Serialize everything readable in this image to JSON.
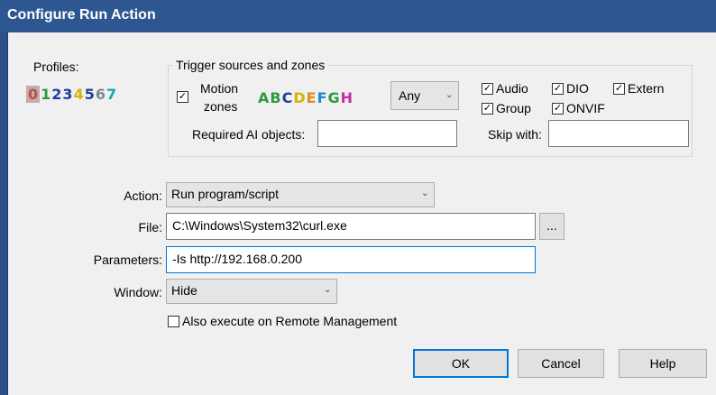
{
  "window": {
    "title": "Configure Run Action"
  },
  "profiles": {
    "label": "Profiles:",
    "items": [
      {
        "label": "0",
        "color": "#b05050"
      },
      {
        "label": "1",
        "color": "#2e9a3a"
      },
      {
        "label": "2",
        "color": "#1a3fa0"
      },
      {
        "label": "3",
        "color": "#1a3fa0"
      },
      {
        "label": "4",
        "color": "#d4b400"
      },
      {
        "label": "5",
        "color": "#1a3fa0"
      },
      {
        "label": "6",
        "color": "#7a8a8a"
      },
      {
        "label": "7",
        "color": "#18a8a8"
      }
    ]
  },
  "trigger": {
    "legend": "Trigger sources and zones",
    "motion_label_line1": "Motion",
    "motion_label_line2": "zones",
    "motion_checked": true,
    "zones": [
      {
        "label": "A",
        "color": "#2e9a3a"
      },
      {
        "label": "B",
        "color": "#2e9a3a"
      },
      {
        "label": "C",
        "color": "#1a3fa0"
      },
      {
        "label": "D",
        "color": "#d4b400"
      },
      {
        "label": "E",
        "color": "#e08a1a"
      },
      {
        "label": "F",
        "color": "#1a8ad0"
      },
      {
        "label": "G",
        "color": "#2e9a3a"
      },
      {
        "label": "H",
        "color": "#c0309a"
      }
    ],
    "zone_mode": "Any",
    "sources": {
      "audio": {
        "label": "Audio",
        "checked": true
      },
      "dio": {
        "label": "DIO",
        "checked": true
      },
      "extern": {
        "label": "Extern",
        "checked": true
      },
      "group": {
        "label": "Group",
        "checked": true
      },
      "onvif": {
        "label": "ONVIF",
        "checked": true
      }
    },
    "required_ai_label": "Required AI objects:",
    "required_ai_value": "",
    "skip_with_label": "Skip with:",
    "skip_with_value": ""
  },
  "form": {
    "action_label": "Action:",
    "action_value": "Run program/script",
    "file_label": "File:",
    "file_value": "C:\\Windows\\System32\\curl.exe",
    "browse_label": "...",
    "parameters_label": "Parameters:",
    "parameters_value": "-Is http://192.168.0.200",
    "window_label": "Window:",
    "window_value": "Hide",
    "remote_label": "Also execute on Remote Management",
    "remote_checked": false
  },
  "buttons": {
    "ok": "OK",
    "cancel": "Cancel",
    "help": "Help"
  },
  "colors": {
    "title_bar": "#2e5792",
    "focus_border": "#0078d7",
    "dialog_bg": "#f0f0f0"
  }
}
